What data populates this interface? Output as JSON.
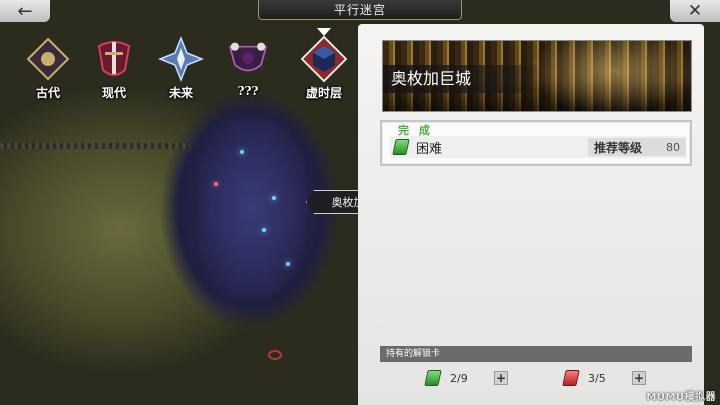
{
  "header": {
    "title": "平行迷宫",
    "back_icon": "back-arrow-icon",
    "close_icon": "close-x-icon"
  },
  "eras": [
    {
      "label": "古代",
      "icon": "ancient-emblem-icon",
      "color": "#c8b070"
    },
    {
      "label": "现代",
      "icon": "modern-sword-emblem-icon",
      "color": "#d04060"
    },
    {
      "label": "未来",
      "icon": "future-crystal-emblem-icon",
      "color": "#a8c8ff"
    },
    {
      "label": "???",
      "icon": "mystery-emblem-icon",
      "color": "#b060c0"
    },
    {
      "label": "虚时层",
      "icon": "cube-emblem-icon",
      "color": "#e04040",
      "selected": true
    }
  ],
  "map": {
    "location_label": "奥枚加巨城"
  },
  "panel": {
    "banner_title": "奥枚加巨城",
    "stage": {
      "status": "完 成",
      "difficulty": "困难",
      "ticket_icon": "green-ticket-icon",
      "recommended_label": "推荐等级",
      "recommended_value": "80"
    },
    "keys_label": "持有的解锁卡",
    "keys": [
      {
        "icon": "green-key-card-icon",
        "count": "2/9"
      },
      {
        "icon": "red-key-card-icon",
        "count": "3/5"
      }
    ]
  },
  "watermark": "MUMU模拟器",
  "colors": {
    "accent_green": "#4cae3e",
    "panel_bg": "#f0f0ee"
  }
}
